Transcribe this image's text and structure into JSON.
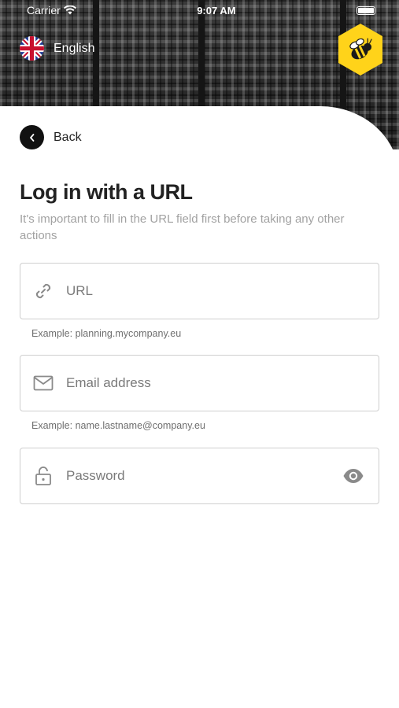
{
  "status_bar": {
    "carrier": "Carrier",
    "time": "9:07 AM"
  },
  "header": {
    "language_label": "English",
    "logo_icon": "bee-hexagon-logo",
    "brand_color": "#FFD31A"
  },
  "back": {
    "label": "Back"
  },
  "title": "Log in with a URL",
  "subtitle": "It's important to fill in the URL field first before taking any other actions",
  "fields": {
    "url": {
      "placeholder": "URL",
      "helper": "Example: planning.mycompany.eu",
      "icon": "link-icon"
    },
    "email": {
      "placeholder": "Email address",
      "helper": "Example: name.lastname@company.eu",
      "icon": "mail-icon"
    },
    "password": {
      "placeholder": "Password",
      "icon": "lock-icon",
      "toggle_icon": "eye-icon"
    }
  }
}
